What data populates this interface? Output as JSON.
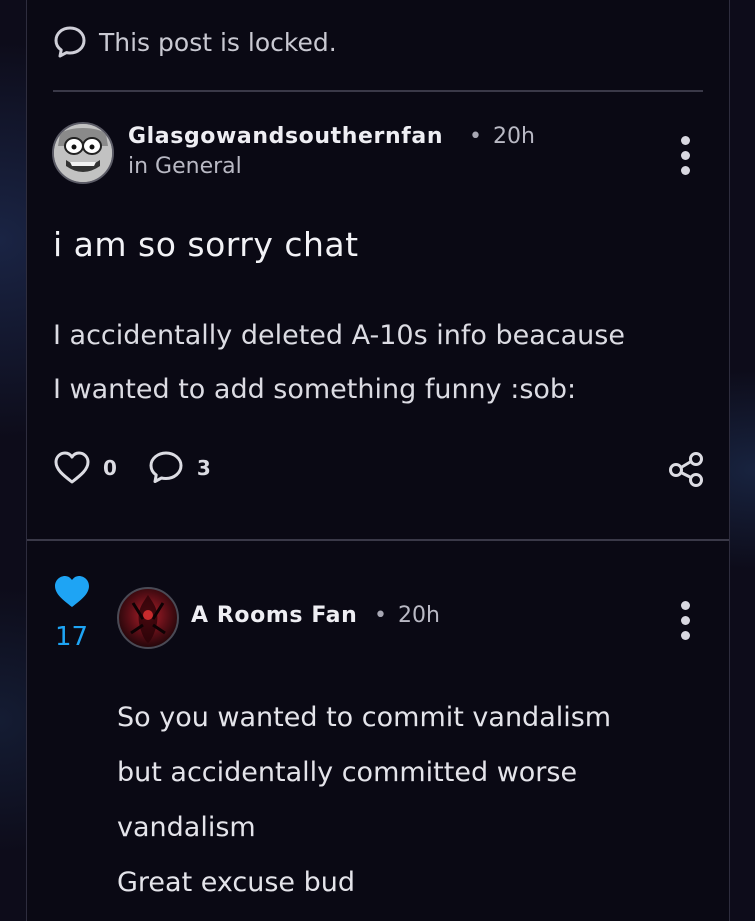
{
  "locked_notice": {
    "text": "This post is locked.",
    "icon": "speech-bubble-icon"
  },
  "post": {
    "author": "Glasgowandsouthernfan",
    "separator": "•",
    "time": "20h",
    "category": "in General",
    "title": "i am so sorry chat",
    "body_lines": [
      "I accidentally deleted A-10s info beacause",
      "I wanted to add something funny :sob:"
    ],
    "likes": "0",
    "comments": "3",
    "icons": {
      "like": "heart-outline-icon",
      "comment": "speech-bubble-icon",
      "share": "share-icon",
      "menu": "kebab-menu-icon"
    }
  },
  "reply": {
    "author": "A Rooms Fan",
    "separator": "•",
    "time": "20h",
    "votes": "17",
    "vote_color": "#1ea4f4",
    "body_lines": [
      "So you wanted to commit vandalism",
      "but accidentally committed worse",
      "vandalism",
      "Great excuse bud"
    ],
    "icons": {
      "vote": "heart-filled-icon",
      "menu": "kebab-menu-icon"
    }
  }
}
